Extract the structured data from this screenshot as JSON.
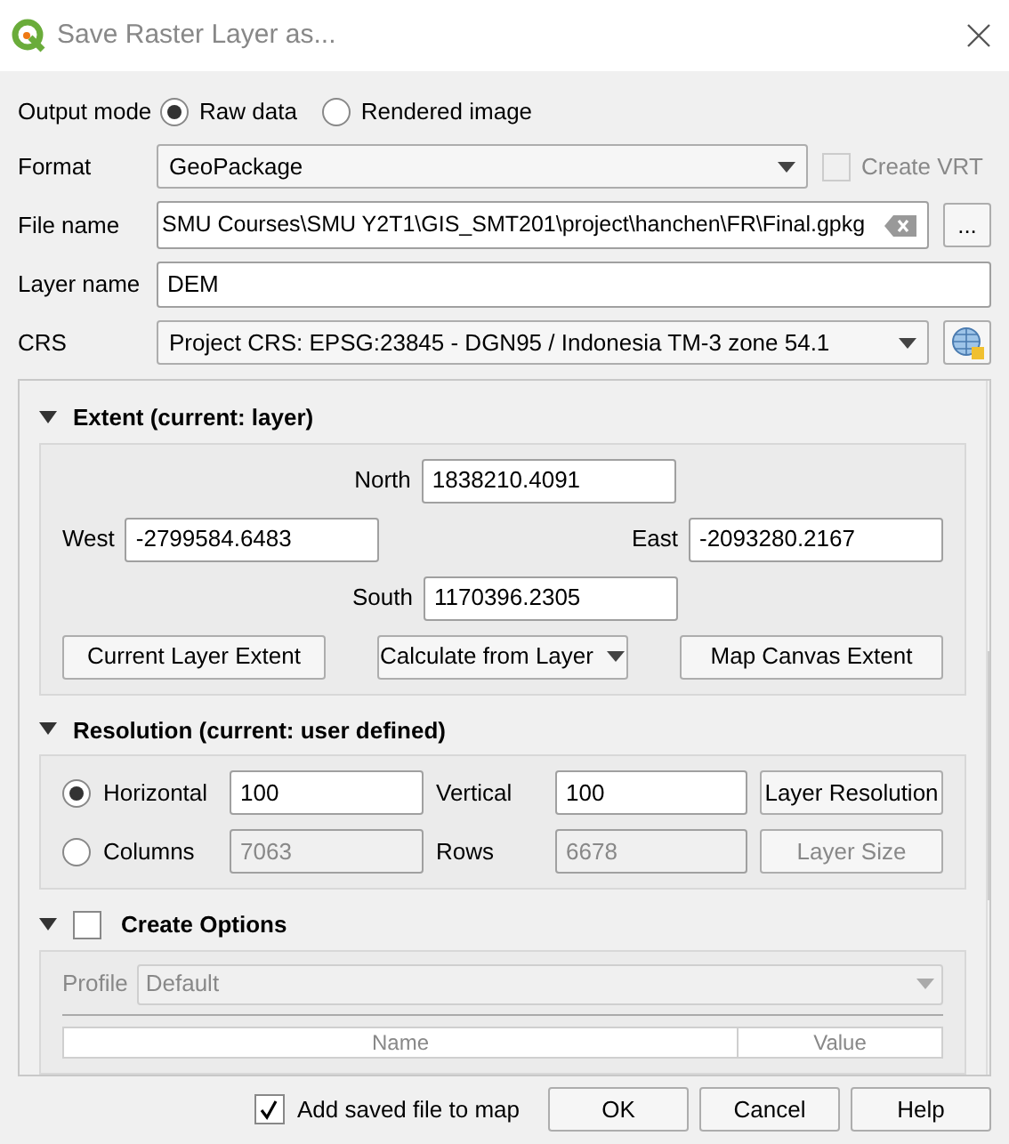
{
  "window": {
    "title": "Save Raster Layer as..."
  },
  "output_mode": {
    "label": "Output mode",
    "options": [
      {
        "label": "Raw data",
        "selected": true
      },
      {
        "label": "Rendered image",
        "selected": false
      }
    ]
  },
  "format": {
    "label": "Format",
    "value": "GeoPackage",
    "create_vrt": {
      "label": "Create VRT",
      "checked": false,
      "disabled": true
    }
  },
  "file_name": {
    "label": "File name",
    "value": "SMU Courses\\SMU Y2T1\\GIS_SMT201\\project\\hanchen\\FR\\Final.gpkg",
    "browse": "..."
  },
  "layer_name": {
    "label": "Layer name",
    "value": "DEM"
  },
  "crs": {
    "label": "CRS",
    "value": "Project CRS: EPSG:23845 - DGN95 / Indonesia TM-3 zone 54.1"
  },
  "extent": {
    "title": "Extent (current: layer)",
    "expanded": true,
    "north": {
      "label": "North",
      "value": "1838210.4091"
    },
    "west": {
      "label": "West",
      "value": "-2799584.6483"
    },
    "east": {
      "label": "East",
      "value": "-2093280.2167"
    },
    "south": {
      "label": "South",
      "value": "1170396.2305"
    },
    "buttons": [
      {
        "label": "Current Layer Extent",
        "kind": "button"
      },
      {
        "label": "Calculate from Layer",
        "kind": "menu"
      },
      {
        "label": "Map Canvas Extent",
        "kind": "button"
      }
    ]
  },
  "resolution": {
    "title": "Resolution (current: user defined)",
    "expanded": true,
    "rows": [
      {
        "label": "Horizontal",
        "selected": true,
        "value": "100",
        "label_2": "Vertical",
        "value_2": "100",
        "button": "Layer Resolution"
      },
      {
        "label": "Columns",
        "selected": false,
        "value": "7063",
        "label_2": "Rows",
        "value_2": "6678",
        "button": "Layer Size"
      }
    ]
  },
  "create_options": {
    "title": "Create Options",
    "expanded": true,
    "checked": false,
    "profile": {
      "label": "Profile",
      "value": "Default"
    },
    "table": {
      "columns": [
        "Name",
        "Value"
      ]
    }
  },
  "add_to_map": {
    "label": "Add saved file to map",
    "checked": true
  },
  "buttons": [
    "OK",
    "Cancel",
    "Help"
  ]
}
